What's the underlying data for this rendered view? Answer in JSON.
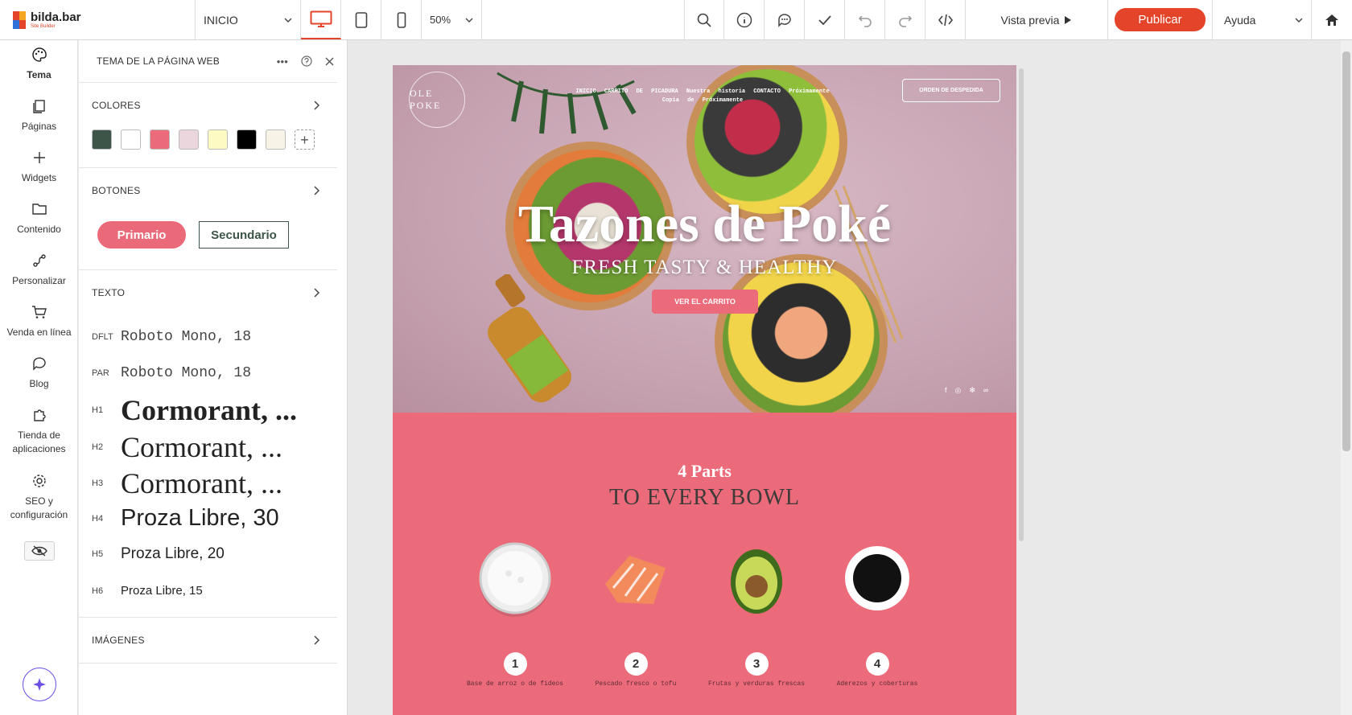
{
  "app": {
    "logo_name": "bilda.bar",
    "logo_sub": "Site Builder"
  },
  "topbar": {
    "page_select": "INICIO",
    "zoom": "50%",
    "preview_label": "Vista previa",
    "publish_label": "Publicar",
    "help_label": "Ayuda",
    "accent": "#e4452a"
  },
  "rail": {
    "items": [
      {
        "label": "Tema",
        "icon": "palette-icon"
      },
      {
        "label": "Páginas",
        "icon": "pages-icon"
      },
      {
        "label": "Widgets",
        "icon": "plus-icon"
      },
      {
        "label": "Contenido",
        "icon": "folder-icon"
      },
      {
        "label": "Personalizar",
        "icon": "customize-icon"
      },
      {
        "label": "Venda en línea",
        "icon": "cart-icon"
      },
      {
        "label": "Blog",
        "icon": "chat-bubble-icon"
      },
      {
        "label": "Tienda de aplicaciones",
        "icon": "puzzle-icon"
      },
      {
        "label": "SEO y configuración",
        "icon": "gear-icon"
      }
    ]
  },
  "panel": {
    "title": "TEMA DE LA PÁGINA WEB",
    "colors_label": "COLORES",
    "colors": [
      "#3d5549",
      "#ffffff",
      "#ec6b7b",
      "#ebd6dd",
      "#fdfbc3",
      "#000000",
      "#f7f3e6"
    ],
    "buttons_label": "BOTONES",
    "primary_label": "Primario",
    "secondary_label": "Secundario",
    "text_label": "TEXTO",
    "typography": [
      {
        "tag": "DFLT",
        "sample": "Roboto Mono, 18"
      },
      {
        "tag": "PAR",
        "sample": "Roboto Mono, 18"
      },
      {
        "tag": "H1",
        "sample": "Cormorant, ..."
      },
      {
        "tag": "H2",
        "sample": "Cormorant, ..."
      },
      {
        "tag": "H3",
        "sample": "Cormorant, ..."
      },
      {
        "tag": "H4",
        "sample": "Proza Libre, 30"
      },
      {
        "tag": "H5",
        "sample": "Proza Libre, 20"
      },
      {
        "tag": "H6",
        "sample": "Proza Libre, 15"
      }
    ],
    "images_label": "IMÁGENES"
  },
  "site": {
    "brand": "OLE POKE",
    "nav_line1": "INICIO CARRITO DE PICADURA Nuestra historia CONTACTO Próximamente",
    "nav_line2": "Copia de Próximamente",
    "order_button": "ORDEN DE DESPEDIDA",
    "hero_title": "Tazones de Poké",
    "hero_subtitle": "FRESH TASTY & HEALTHY",
    "hero_cta": "VER EL CARRITO",
    "parts_title": "4 Parts",
    "parts_subtitle": "TO EVERY BOWL",
    "parts": [
      {
        "num": "1",
        "label": "Base de arroz o de fideos"
      },
      {
        "num": "2",
        "label": "Pescado fresco o tofu"
      },
      {
        "num": "3",
        "label": "Frutas y verduras frescas"
      },
      {
        "num": "4",
        "label": "Aderezos y coberturas"
      }
    ]
  }
}
